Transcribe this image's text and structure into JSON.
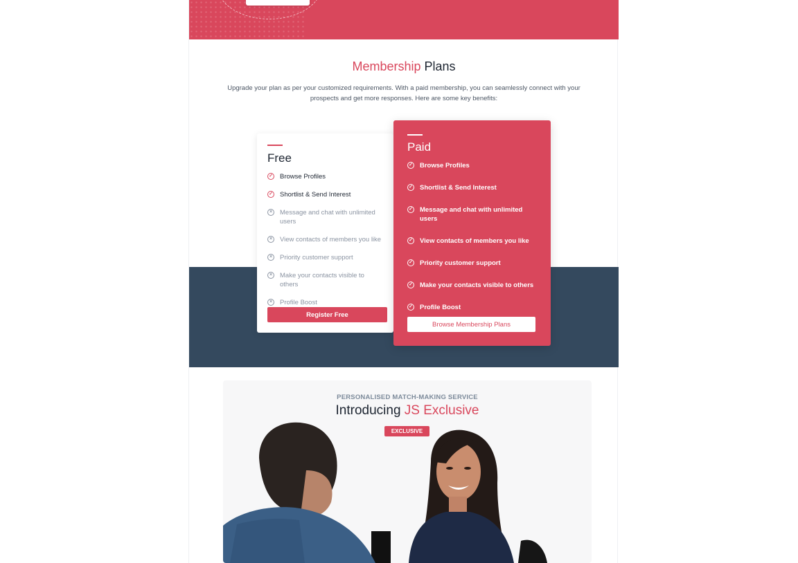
{
  "membership": {
    "title_accent": "Membership",
    "title_rest": " Plans",
    "description": "Upgrade your plan as per your customized requirements. With a paid membership, you can seamlessly connect with your prospects and get more responses. Here are some key benefits:",
    "free": {
      "name": "Free",
      "features": [
        {
          "label": "Browse Profiles",
          "included": true
        },
        {
          "label": "Shortlist & Send Interest",
          "included": true
        },
        {
          "label": "Message and chat with unlimited users",
          "included": false
        },
        {
          "label": "View contacts of members you like",
          "included": false
        },
        {
          "label": "Priority customer support",
          "included": false
        },
        {
          "label": "Make your contacts visible to others",
          "included": false
        },
        {
          "label": "Profile Boost",
          "included": false
        }
      ],
      "button_label": "Register Free"
    },
    "paid": {
      "name": "Paid",
      "features": [
        {
          "label": "Browse Profiles"
        },
        {
          "label": "Shortlist & Send Interest"
        },
        {
          "label": "Message and chat with unlimited users"
        },
        {
          "label": "View contacts of members you like"
        },
        {
          "label": "Priority customer support"
        },
        {
          "label": "Make your contacts visible to others"
        },
        {
          "label": "Profile Boost"
        }
      ],
      "button_label": "Browse Membership Plans"
    }
  },
  "exclusive": {
    "kicker": "PERSONALISED MATCH-MAKING SERVICE",
    "title_prefix": "Introducing ",
    "title_accent": "JS Exclusive",
    "badge": "EXCLUSIVE"
  },
  "colors": {
    "brand": "#d9475c",
    "band": "#34495e",
    "text_dark": "#1c2430",
    "text_muted": "#8a93a1"
  },
  "icons": {
    "included": "check-circle-icon",
    "excluded": "x-circle-icon"
  }
}
